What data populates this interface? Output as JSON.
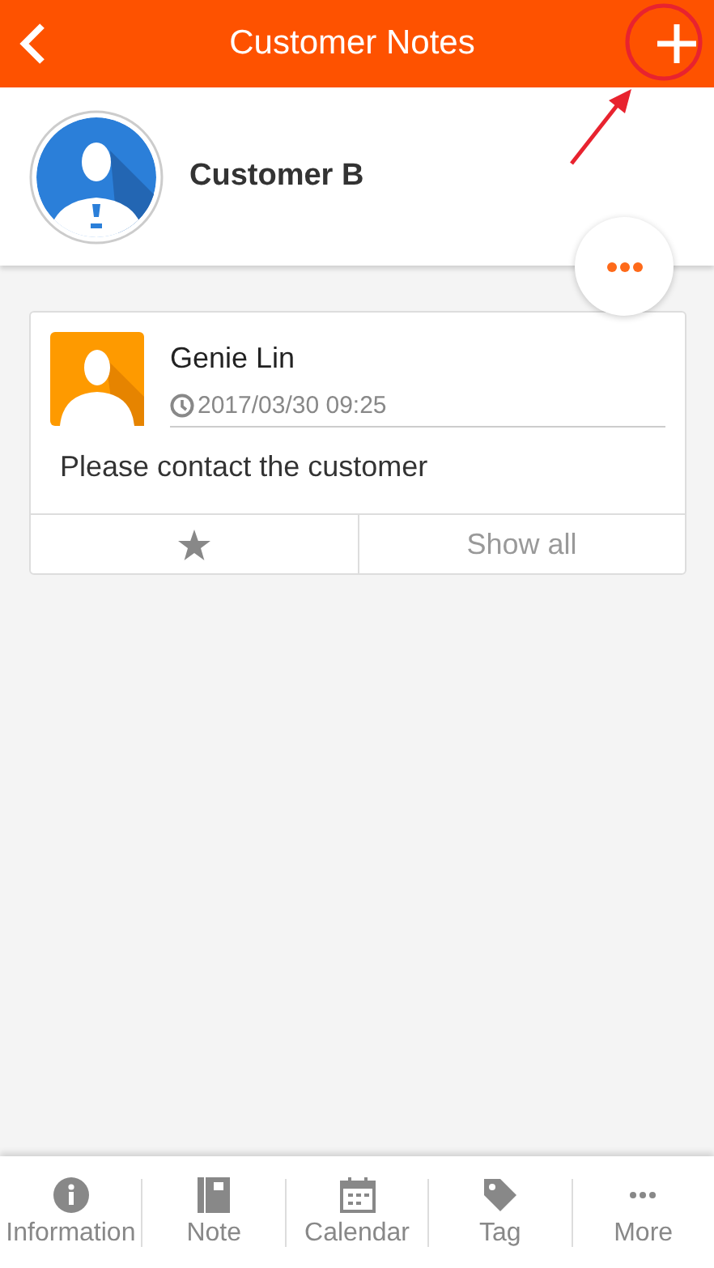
{
  "header": {
    "title": "Customer Notes"
  },
  "annotation": {
    "kind": "circle-arrow"
  },
  "customer": {
    "name": "Customer B"
  },
  "notes": [
    {
      "author": "Genie Lin",
      "time": "2017/03/30 09:25",
      "text": "Please contact the customer",
      "action": "Show all"
    }
  ],
  "tabs": [
    {
      "label": "Information",
      "kind": "info"
    },
    {
      "label": "Note",
      "kind": "note"
    },
    {
      "label": "Calendar",
      "kind": "calendar"
    },
    {
      "label": "Tag",
      "kind": "tag"
    },
    {
      "label": "More",
      "kind": "more"
    }
  ]
}
